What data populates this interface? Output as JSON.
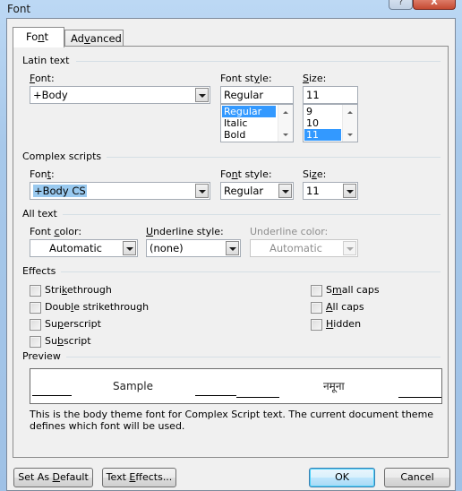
{
  "window": {
    "title": "Font",
    "help_glyph": "?",
    "close_glyph": "X"
  },
  "tabs": [
    {
      "label_pre": "Fo",
      "label_ul": "n",
      "label_post": "t",
      "active": true
    },
    {
      "label_pre": "Ad",
      "label_ul": "v",
      "label_post": "anced",
      "active": false
    }
  ],
  "latin": {
    "group": "Latin text",
    "font_label_ul": "F",
    "font_label_post": "ont:",
    "font_value": "+Body",
    "style_label_pre": "Font st",
    "style_label_ul": "y",
    "style_label_post": "le:",
    "style_value": "Regular",
    "style_options": [
      "Regular",
      "Italic",
      "Bold"
    ],
    "style_selected": "Regular",
    "size_label_ul": "S",
    "size_label_post": "ize:",
    "size_value": "11",
    "size_options": [
      "9",
      "10",
      "11"
    ],
    "size_selected": "11"
  },
  "complex": {
    "group": "Complex scripts",
    "font_label_pre": "Fon",
    "font_label_ul": "t",
    "font_label_post": ":",
    "font_value": "+Body CS",
    "style_label_pre": "Fo",
    "style_label_ul": "n",
    "style_label_post": "t style:",
    "style_value": "Regular",
    "size_label_pre": "Si",
    "size_label_ul": "z",
    "size_label_post": "e:",
    "size_value": "11"
  },
  "all_text": {
    "group": "All text",
    "font_color_label_pre": "Font ",
    "font_color_label_ul": "c",
    "font_color_label_post": "olor:",
    "font_color_value": "Automatic",
    "underline_style_label_ul": "U",
    "underline_style_label_post": "nderline style:",
    "underline_style_value": "(none)",
    "underline_color_label": "Underline color:",
    "underline_color_value": "Automatic",
    "underline_color_enabled": false
  },
  "effects": {
    "group": "Effects",
    "left": [
      {
        "pre": "Stri",
        "ul": "k",
        "post": "ethrough",
        "checked": false
      },
      {
        "pre": "Doub",
        "ul": "l",
        "post": "e strikethrough",
        "checked": false
      },
      {
        "pre": "Su",
        "ul": "p",
        "post": "erscript",
        "checked": false
      },
      {
        "pre": "Su",
        "ul": "b",
        "post": "script",
        "checked": false
      }
    ],
    "right": [
      {
        "pre": "S",
        "ul": "m",
        "post": "all caps",
        "checked": false
      },
      {
        "pre": "",
        "ul": "A",
        "post": "ll caps",
        "checked": false
      },
      {
        "pre": "",
        "ul": "H",
        "post": "idden",
        "checked": false
      }
    ]
  },
  "preview": {
    "group": "Preview",
    "sample_latin": "Sample",
    "sample_complex": "नमूना",
    "description": "This is the body theme font for Complex Script text. The current document theme defines which font will be used."
  },
  "buttons": {
    "set_default_pre": "Set As ",
    "set_default_ul": "D",
    "set_default_post": "efault",
    "text_effects_pre": "Text ",
    "text_effects_ul": "E",
    "text_effects_post": "ffects...",
    "ok": "OK",
    "cancel": "Cancel"
  }
}
